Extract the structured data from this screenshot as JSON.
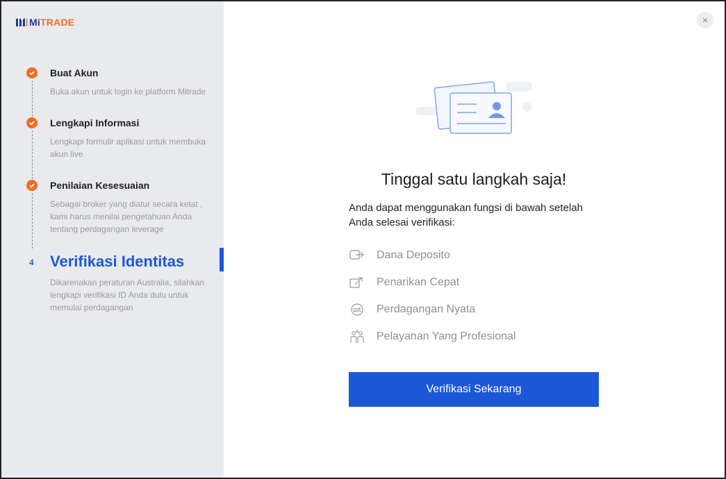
{
  "brand": {
    "logo_mi": "Mi",
    "logo_trade": "TRADE",
    "primary_color": "#1b58d8",
    "accent_color": "#f26d21"
  },
  "steps": [
    {
      "title": "Buat Akun",
      "desc": "Buka akun untuk login ke platform Mitrade",
      "status": "done"
    },
    {
      "title": "Lengkapi Informasi",
      "desc": "Lengkapi formulir aplikasi untuk membuka akun live",
      "status": "done"
    },
    {
      "title": "Penilaian Kesesuaian",
      "desc": "Sebagai broker yang diatur secara ketat , kami harus menilai pengetahuan Anda tentang perdagangan leverage",
      "status": "done"
    },
    {
      "number": "4",
      "title": "Verifikasi Identitas",
      "desc": "Dikarenakan peraturan Australia, silahkan lengkapi verifikasi ID Anda dulu untuk memulai perdagangan",
      "status": "active"
    }
  ],
  "main": {
    "close_icon": "×",
    "heading": "Tinggal satu langkah saja!",
    "intro": "Anda dapat menggunakan fungsi di bawah setelah Anda selesai verifikasi:",
    "features": [
      {
        "icon": "deposit-icon",
        "label": "Dana Deposito"
      },
      {
        "icon": "withdraw-icon",
        "label": "Penarikan Cepat"
      },
      {
        "icon": "trade-icon",
        "label": "Perdagangan Nyata"
      },
      {
        "icon": "service-icon",
        "label": "Pelayanan Yang Profesional"
      }
    ],
    "cta_label": "Verifikasi Sekarang"
  }
}
